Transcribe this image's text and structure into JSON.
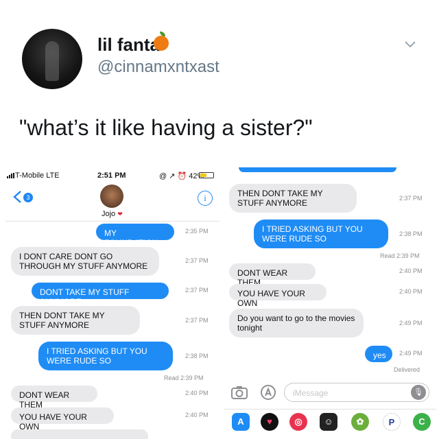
{
  "tweet": {
    "display_name": "lil fanta",
    "handle": "@cinnamxntxast",
    "text": "\"what’s it like having a sister?\""
  },
  "left": {
    "status": {
      "carrier": "T-Mobile  LTE",
      "time": "2:51 PM",
      "right": "@ ↗ ⏰ 42%"
    },
    "back_badge": "3",
    "contact_name": "Jojo",
    "info_glyph": "i",
    "messages": [
      {
        "text": "MY FOUNDATION",
        "time": "2:35 PM"
      },
      {
        "text": "I DONT CARE DONT GO THROUGH MY STUFF ANYMORE",
        "time": "2:37 PM"
      },
      {
        "text": "DONT TAKE MY STUFF ANYMORE",
        "time": "2:37 PM"
      },
      {
        "text": "THEN DONT TAKE MY STUFF ANYMORE",
        "time": "2:37 PM"
      },
      {
        "text": "I TRIED ASKING BUT YOU WERE RUDE SO",
        "time": "2:38 PM"
      },
      {
        "text": "DONT WEAR THEM",
        "time": "2:40 PM"
      },
      {
        "text": "YOU HAVE YOUR OWN",
        "time": "2:40 PM"
      }
    ],
    "read_receipt": "Read 2:39 PM"
  },
  "right": {
    "messages": [
      {
        "text": "THEN DONT TAKE MY STUFF ANYMORE",
        "time": "2:37 PM"
      },
      {
        "text": "I TRIED ASKING BUT YOU WERE RUDE SO",
        "time": "2:38 PM"
      },
      {
        "text": "DONT WEAR THEM",
        "time": "2:40 PM"
      },
      {
        "text": "YOU HAVE YOUR OWN",
        "time": "2:40 PM"
      },
      {
        "text": "Do you want to go to the movies tonight",
        "time": "2:49 PM"
      },
      {
        "text": "yes",
        "time": "2:49 PM"
      }
    ],
    "read_receipt": "Read 2:39 PM",
    "delivered": "Delivered",
    "compose_placeholder": "iMessage",
    "app_drawer": [
      "app-store-icon",
      "heart-app-icon",
      "search-app-icon",
      "game-app-icon",
      "sticker-app-icon",
      "pandora-app-icon",
      "green-app-icon"
    ]
  },
  "colors": {
    "sent_bubble": "#1f8cf5",
    "received_bubble": "#e9e9eb",
    "handle": "#657786"
  }
}
